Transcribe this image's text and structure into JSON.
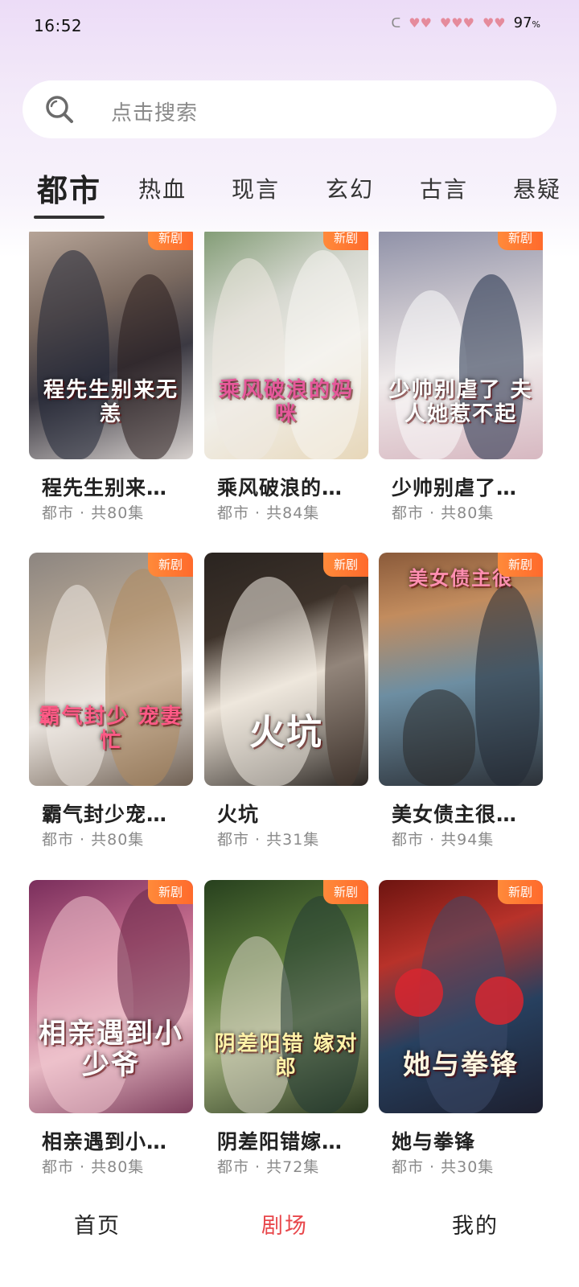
{
  "status_bar": {
    "time": "16:52",
    "battery": "97",
    "battery_unit": "%"
  },
  "search": {
    "placeholder": "点击搜索"
  },
  "tabs": [
    {
      "label": "都市",
      "active": true
    },
    {
      "label": "热血",
      "active": false
    },
    {
      "label": "现言",
      "active": false
    },
    {
      "label": "玄幻",
      "active": false
    },
    {
      "label": "古言",
      "active": false
    },
    {
      "label": "悬疑",
      "active": false
    }
  ],
  "cards": [
    {
      "title": "程先生别来…",
      "poster_text": "程先生别来无恙",
      "meta": "都市 · 共80集",
      "badge": "新剧"
    },
    {
      "title": "乘风破浪的…",
      "poster_text": "乘风破浪的妈咪",
      "meta": "都市 · 共84集",
      "badge": "新剧"
    },
    {
      "title": "少帅别虐了…",
      "poster_text": "少帅别虐了 夫人她惹不起",
      "meta": "都市 · 共80集",
      "badge": "新剧"
    },
    {
      "title": "霸气封少宠…",
      "poster_text": "霸气封少 宠妻忙",
      "meta": "都市 · 共80集",
      "badge": "新剧"
    },
    {
      "title": "火坑",
      "poster_text": "火坑",
      "meta": "都市 · 共31集",
      "badge": "新剧"
    },
    {
      "title": "美女债主很…",
      "poster_text": "美女债主很",
      "meta": "都市 · 共94集",
      "badge": "新剧"
    },
    {
      "title": "相亲遇到小…",
      "poster_text": "相亲遇到小少爷",
      "meta": "都市 · 共80集",
      "badge": "新剧"
    },
    {
      "title": "阴差阳错嫁…",
      "poster_text": "阴差阳错 嫁对郎",
      "meta": "都市 · 共72集",
      "badge": "新剧"
    },
    {
      "title": "她与拳锋",
      "poster_text": "她与拳锋",
      "meta": "都市 · 共30集",
      "badge": "新剧"
    }
  ],
  "bottom_nav": [
    {
      "label": "首页",
      "active": false
    },
    {
      "label": "剧场",
      "active": true
    },
    {
      "label": "我的",
      "active": false
    }
  ],
  "colors": {
    "accent": "#e8474b",
    "badge": "#ff7a33"
  }
}
